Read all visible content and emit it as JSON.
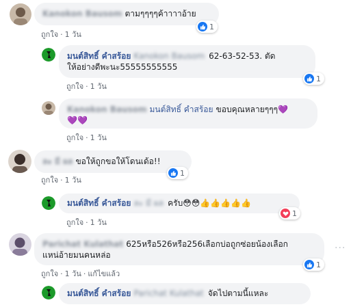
{
  "comments": [
    {
      "author": "Kanokon Bausom",
      "text": "ตามๆๆๆๆค้าาาาอ้าย",
      "actions": {
        "like": "ถูกใจ",
        "time": "1 วัน"
      },
      "reactions": {
        "icon": "like-icon",
        "count": "1"
      }
    },
    {
      "author": "มนต์สิทธิ์ คำสร้อย",
      "mention": "Kanokon Bausom",
      "text_line1": "62-63-52-53. ตัด",
      "text_line2": "ให้อย่างดีพะนะ55555555555",
      "actions": {
        "like": "ถูกใจ",
        "time": "1 วัน"
      },
      "reactions": {
        "icon": "like-icon",
        "count": "1"
      }
    },
    {
      "author": "Kanokon Bausom",
      "mention": "มนต์สิทธิ์ คำสร้อย",
      "text_line1": "ขอบคุณหลายๆๆๆ💜",
      "text_line2": "💜💜",
      "actions": {
        "like": "ถูกใจ",
        "time": "1 วัน"
      }
    },
    {
      "author": "ละ มี ผล",
      "text": "ขอให้ถูกขอให้โดนเด้อ!!",
      "actions": {
        "like": "ถูกใจ",
        "time": "1 วัน"
      },
      "reactions": {
        "icon": "like-icon",
        "count": "1"
      }
    },
    {
      "author": "มนต์สิทธิ์ คำสร้อย",
      "mention": "ละ มี ผล",
      "text": "ครับ😳😳👍👍👍👍👍",
      "actions": {
        "like": "ถูกใจ",
        "time": "1 วัน"
      },
      "reactions": {
        "icon": "love-icon",
        "count": "1"
      }
    },
    {
      "author": "Parichat Kulathat",
      "text_line1": "625หรือ526หรือ256เลือกบ่อถูกซ่อยน้องเลือก",
      "text_line2": "แหน่อ้ายมนคนหล่อ",
      "actions": {
        "like": "ถูกใจ",
        "time": "1 วัน",
        "edited": "แก้ไขแล้ว"
      },
      "reactions": {
        "icon": "like-icon",
        "count": "1"
      }
    },
    {
      "author": "มนต์สิทธิ์ คำสร้อย",
      "mention": "Parichat Kulathat",
      "text": "จัดไปตามนี้แหละ"
    }
  ],
  "more_icon": "more-options-icon",
  "colors": {
    "bubble": "#f2f3f5",
    "name": "#385898",
    "meta": "#606770",
    "like": "#1877f2",
    "love": "#f33e58"
  }
}
